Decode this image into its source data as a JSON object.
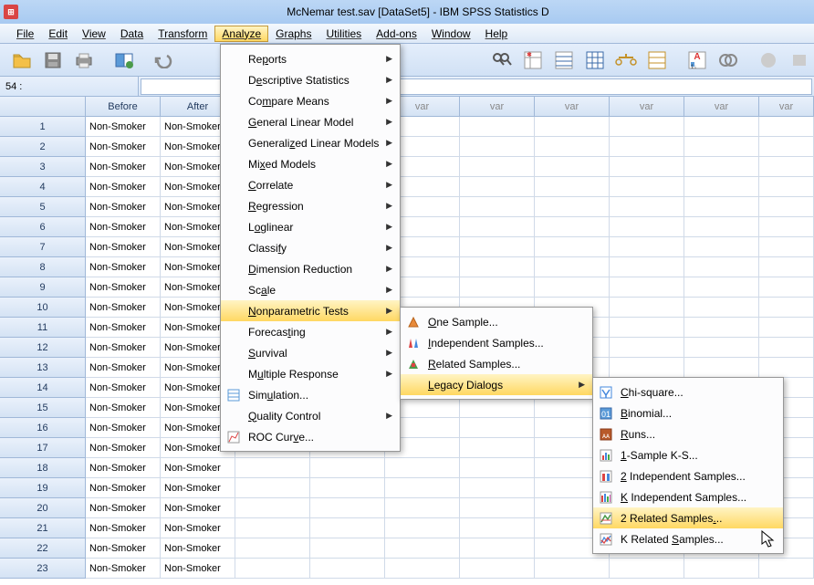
{
  "title": "McNemar test.sav [DataSet5] - IBM SPSS Statistics D",
  "menu": {
    "file": "File",
    "edit": "Edit",
    "view": "View",
    "data": "Data",
    "transform": "Transform",
    "analyze": "Analyze",
    "graphs": "Graphs",
    "utilities": "Utilities",
    "addons": "Add-ons",
    "window": "Window",
    "help": "Help"
  },
  "cellref": "54 :",
  "columns": {
    "before": "Before",
    "after": "After",
    "var": "var"
  },
  "cellvalue": "Non-Smoker",
  "rows": [
    1,
    2,
    3,
    4,
    5,
    6,
    7,
    8,
    9,
    10,
    11,
    12,
    13,
    14,
    15,
    16,
    17,
    18,
    19,
    20,
    21,
    22,
    23
  ],
  "analyze": {
    "reports": "Reports",
    "descriptive": "Descriptive Statistics",
    "compare": "Compare Means",
    "glm": "General Linear Model",
    "genlin": "Generalized Linear Models",
    "mixed": "Mixed Models",
    "correlate": "Correlate",
    "regression": "Regression",
    "loglinear": "Loglinear",
    "classify": "Classify",
    "dimred": "Dimension Reduction",
    "scale": "Scale",
    "nonpar": "Nonparametric Tests",
    "forecast": "Forecasting",
    "survival": "Survival",
    "multresp": "Multiple Response",
    "simulation": "Simulation...",
    "quality": "Quality Control",
    "roc": "ROC Curve..."
  },
  "sub": {
    "one": "One Sample...",
    "ind": "Independent Samples...",
    "rel": "Related Samples...",
    "legacy": "Legacy Dialogs"
  },
  "legacy": {
    "chi": "Chi-square...",
    "binomial": "Binomial...",
    "runs": "Runs...",
    "ks": "1-Sample K-S...",
    "ind2": "2 Independent Samples...",
    "indk": "K Independent Samples...",
    "rel2": "2 Related Samples...",
    "relk": "K Related Samples..."
  }
}
